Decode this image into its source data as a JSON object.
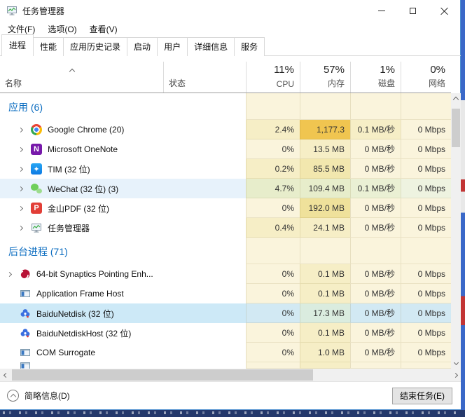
{
  "window": {
    "title": "任务管理器",
    "menu": [
      "文件(F)",
      "选项(O)",
      "查看(V)"
    ],
    "controls": [
      "minimize",
      "maximize",
      "close"
    ]
  },
  "tabs": [
    {
      "label": "进程",
      "active": true
    },
    {
      "label": "性能",
      "active": false
    },
    {
      "label": "应用历史记录",
      "active": false
    },
    {
      "label": "启动",
      "active": false
    },
    {
      "label": "用户",
      "active": false
    },
    {
      "label": "详细信息",
      "active": false
    },
    {
      "label": "服务",
      "active": false
    }
  ],
  "table": {
    "name_header": "名称",
    "status_header": "状态",
    "sort_icon": "chevron-up",
    "metric_headers": [
      {
        "value": "11%",
        "label": "CPU"
      },
      {
        "value": "57%",
        "label": "内存"
      },
      {
        "value": "1%",
        "label": "磁盘"
      },
      {
        "value": "0%",
        "label": "网络"
      }
    ],
    "sections": [
      {
        "label": "应用 (6)",
        "indent": "app",
        "rows": [
          {
            "icon": "chrome",
            "expandable": true,
            "name": "Google Chrome (20)",
            "state": "normal",
            "cells": [
              {
                "v": "2.4%",
                "h": "l1"
              },
              {
                "v": "1,177.3",
                "h": "hot"
              },
              {
                "v": "0.1 MB/秒",
                "h": "l1"
              },
              {
                "v": "0 Mbps",
                "h": "l0"
              }
            ]
          },
          {
            "icon": "onenote",
            "expandable": true,
            "name": "Microsoft OneNote",
            "state": "normal",
            "cells": [
              {
                "v": "0%",
                "h": "l0"
              },
              {
                "v": "13.5 MB",
                "h": "l1"
              },
              {
                "v": "0 MB/秒",
                "h": "l0"
              },
              {
                "v": "0 Mbps",
                "h": "l0"
              }
            ]
          },
          {
            "icon": "tim",
            "expandable": true,
            "name": "TIM (32 位)",
            "state": "normal",
            "cells": [
              {
                "v": "0.2%",
                "h": "l1"
              },
              {
                "v": "85.5 MB",
                "h": "l2"
              },
              {
                "v": "0 MB/秒",
                "h": "l0"
              },
              {
                "v": "0 Mbps",
                "h": "l0"
              }
            ]
          },
          {
            "icon": "wechat",
            "expandable": true,
            "name": "WeChat (32 位) (3)",
            "state": "hover",
            "cells": [
              {
                "v": "4.7%",
                "h": "h2"
              },
              {
                "v": "109.4 MB",
                "h": "h2"
              },
              {
                "v": "0.1 MB/秒",
                "h": "h1"
              },
              {
                "v": "0 Mbps",
                "h": "h0"
              }
            ]
          },
          {
            "icon": "kingsoft-pdf",
            "expandable": true,
            "name": "金山PDF (32 位)",
            "state": "normal",
            "cells": [
              {
                "v": "0%",
                "h": "l0"
              },
              {
                "v": "192.0 MB",
                "h": "l3"
              },
              {
                "v": "0 MB/秒",
                "h": "l0"
              },
              {
                "v": "0 Mbps",
                "h": "l0"
              }
            ]
          },
          {
            "icon": "taskmgr",
            "expandable": true,
            "name": "任务管理器",
            "state": "normal",
            "cells": [
              {
                "v": "0.4%",
                "h": "l1"
              },
              {
                "v": "24.1 MB",
                "h": "l1"
              },
              {
                "v": "0 MB/秒",
                "h": "l0"
              },
              {
                "v": "0 Mbps",
                "h": "l0"
              }
            ]
          }
        ]
      },
      {
        "label": "后台进程 (71)",
        "indent": "bg",
        "rows": [
          {
            "icon": "synaptics",
            "expandable": true,
            "name": "64-bit Synaptics Pointing Enh...",
            "state": "normal",
            "cells": [
              {
                "v": "0%",
                "h": "l0"
              },
              {
                "v": "0.1 MB",
                "h": "l1"
              },
              {
                "v": "0 MB/秒",
                "h": "l0"
              },
              {
                "v": "0 Mbps",
                "h": "l0"
              }
            ]
          },
          {
            "icon": "window-frame",
            "expandable": false,
            "name": "Application Frame Host",
            "state": "normal",
            "cells": [
              {
                "v": "0%",
                "h": "l0"
              },
              {
                "v": "0.1 MB",
                "h": "l1"
              },
              {
                "v": "0 MB/秒",
                "h": "l0"
              },
              {
                "v": "0 Mbps",
                "h": "l0"
              }
            ]
          },
          {
            "icon": "baidunetdisk",
            "expandable": false,
            "name": "BaiduNetdisk (32 位)",
            "state": "selected",
            "cells": [
              {
                "v": "0%",
                "h": "s0"
              },
              {
                "v": "17.3 MB",
                "h": "s1"
              },
              {
                "v": "0 MB/秒",
                "h": "s0"
              },
              {
                "v": "0 Mbps",
                "h": "s0"
              }
            ]
          },
          {
            "icon": "baidunetdisk",
            "expandable": false,
            "name": "BaiduNetdiskHost (32 位)",
            "state": "normal",
            "cells": [
              {
                "v": "0%",
                "h": "l0"
              },
              {
                "v": "0.1 MB",
                "h": "l1"
              },
              {
                "v": "0 MB/秒",
                "h": "l0"
              },
              {
                "v": "0 Mbps",
                "h": "l0"
              }
            ]
          },
          {
            "icon": "window-frame",
            "expandable": false,
            "name": "COM Surrogate",
            "state": "normal",
            "cells": [
              {
                "v": "0%",
                "h": "l0"
              },
              {
                "v": "1.0 MB",
                "h": "l1"
              },
              {
                "v": "0 MB/秒",
                "h": "l0"
              },
              {
                "v": "0 Mbps",
                "h": "l0"
              }
            ]
          },
          {
            "icon": "window-frame",
            "expandable": false,
            "name": "",
            "state": "normal",
            "partial": true,
            "cells": [
              {
                "v": "",
                "h": "l0"
              },
              {
                "v": "",
                "h": "l1"
              },
              {
                "v": "",
                "h": "l0"
              },
              {
                "v": "",
                "h": "l0"
              }
            ]
          }
        ]
      }
    ]
  },
  "statusbar": {
    "details_toggle": "简略信息(D)",
    "end_task_button": "结束任务(E)"
  },
  "colors": {
    "heat_low": "#faf4dc",
    "heat_mid": "#f2e7ae",
    "heat_hot": "#f0c550",
    "selection": "#cde9f7",
    "hover": "#e7f2fb",
    "section_text": "#0a6cc0",
    "window_border": "#4f8fd0"
  }
}
